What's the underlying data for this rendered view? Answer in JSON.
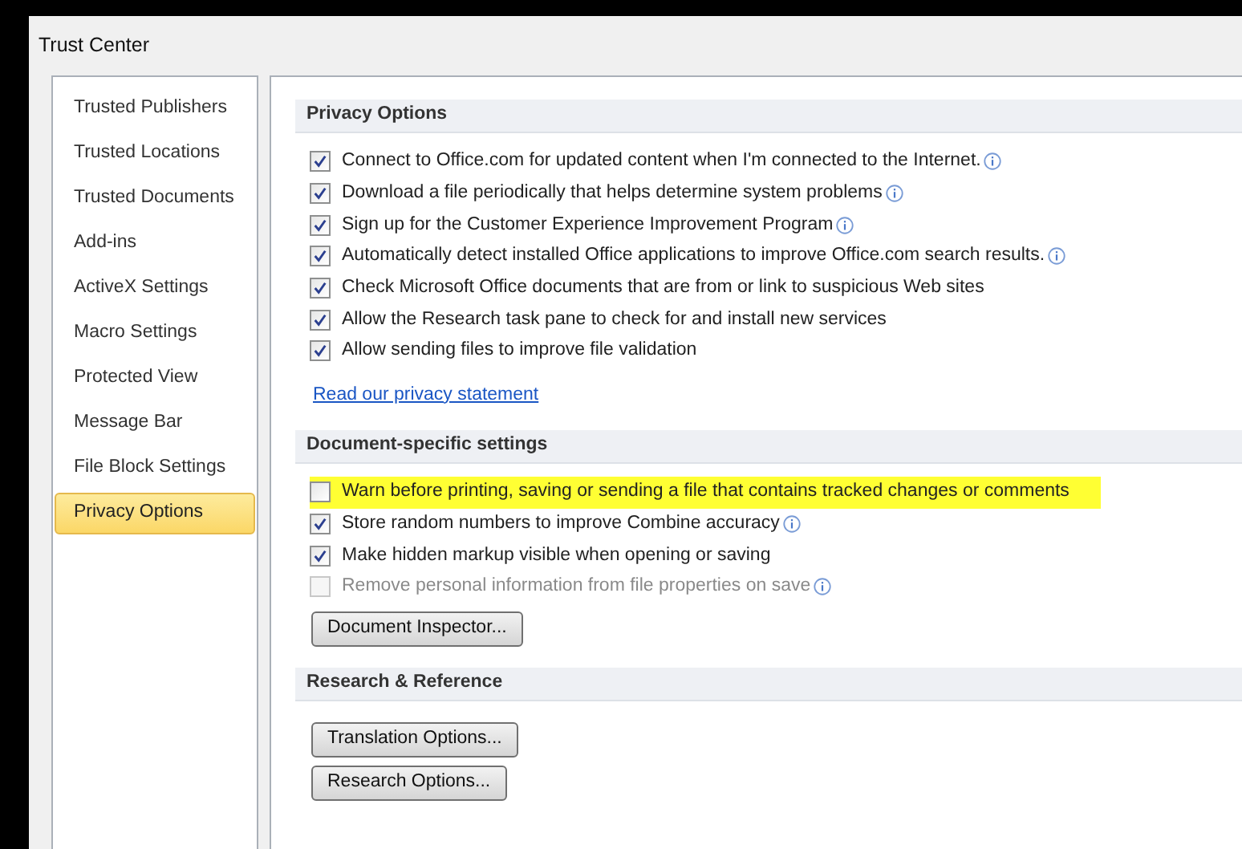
{
  "window": {
    "title": "Trust Center"
  },
  "sidebar": {
    "items": [
      {
        "label": "Trusted Publishers",
        "selected": false
      },
      {
        "label": "Trusted Locations",
        "selected": false
      },
      {
        "label": "Trusted Documents",
        "selected": false
      },
      {
        "label": "Add-ins",
        "selected": false
      },
      {
        "label": "ActiveX Settings",
        "selected": false
      },
      {
        "label": "Macro Settings",
        "selected": false
      },
      {
        "label": "Protected View",
        "selected": false
      },
      {
        "label": "Message Bar",
        "selected": false
      },
      {
        "label": "File Block Settings",
        "selected": false
      },
      {
        "label": "Privacy Options",
        "selected": true
      }
    ]
  },
  "sections": [
    {
      "title": "Privacy Options",
      "options": [
        {
          "label": "Connect to Office.com for updated content when I'm connected to the Internet.",
          "checked": true,
          "info": true,
          "disabled": false,
          "highlighted": false
        },
        {
          "label": "Download a file periodically that helps determine system problems",
          "checked": true,
          "info": true,
          "disabled": false,
          "highlighted": false
        },
        {
          "label": "Sign up for the Customer Experience Improvement Program",
          "checked": true,
          "info": true,
          "disabled": false,
          "highlighted": false
        },
        {
          "label": "Automatically detect installed Office applications to improve Office.com search results.",
          "checked": true,
          "info": true,
          "disabled": false,
          "highlighted": false
        },
        {
          "label": "Check Microsoft Office documents that are from or link to suspicious Web sites",
          "checked": true,
          "info": false,
          "disabled": false,
          "highlighted": false
        },
        {
          "label": "Allow the Research task pane to check for and install new services",
          "checked": true,
          "info": false,
          "disabled": false,
          "highlighted": false
        },
        {
          "label": "Allow sending files to improve file validation",
          "checked": true,
          "info": false,
          "disabled": false,
          "highlighted": false
        }
      ],
      "link": "Read our privacy statement"
    },
    {
      "title": "Document-specific settings",
      "options": [
        {
          "label": "Warn before printing, saving or sending a file that contains tracked changes or comments",
          "checked": false,
          "info": false,
          "disabled": false,
          "highlighted": true
        },
        {
          "label": "Store random numbers to improve Combine accuracy",
          "checked": true,
          "info": true,
          "disabled": false,
          "highlighted": false
        },
        {
          "label": "Make hidden markup visible when opening or saving",
          "checked": true,
          "info": false,
          "disabled": false,
          "highlighted": false
        },
        {
          "label": "Remove personal information from file properties on save",
          "checked": false,
          "info": true,
          "disabled": true,
          "highlighted": false
        }
      ],
      "buttons": [
        "Document Inspector..."
      ]
    },
    {
      "title": "Research & Reference",
      "buttons": [
        "Translation Options...",
        "Research Options..."
      ]
    }
  ]
}
